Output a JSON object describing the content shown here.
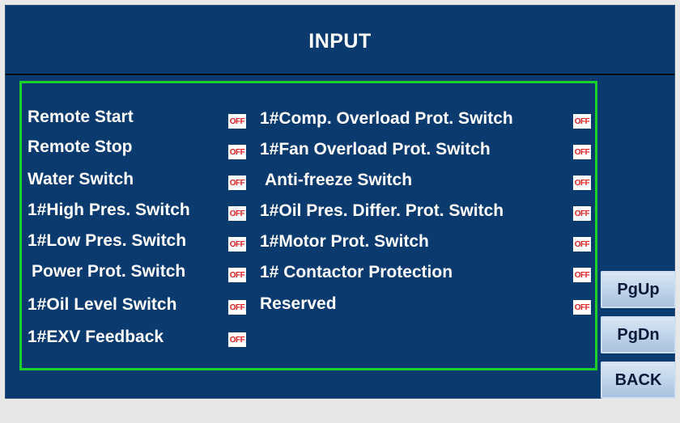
{
  "title": "INPUT",
  "left_items": [
    {
      "label": "Remote Start",
      "status": "OFF"
    },
    {
      "label": "Remote Stop",
      "status": "OFF"
    },
    {
      "label": "Water Switch",
      "status": "OFF"
    },
    {
      "label": "1#High Pres. Switch",
      "status": "OFF"
    },
    {
      "label": "1#Low Pres. Switch",
      "status": "OFF"
    },
    {
      "label": "Power Prot. Switch",
      "status": "OFF"
    },
    {
      "label": "1#Oil Level Switch",
      "status": "OFF"
    },
    {
      "label": "1#EXV Feedback",
      "status": "OFF"
    }
  ],
  "right_items": [
    {
      "label": "1#Comp. Overload Prot. Switch",
      "status": "OFF"
    },
    {
      "label": "1#Fan Overload  Prot. Switch",
      "status": "OFF"
    },
    {
      "label": "Anti-freeze Switch",
      "status": "OFF"
    },
    {
      "label": "1#Oil Pres. Differ. Prot. Switch",
      "status": "OFF"
    },
    {
      "label": "1#Motor Prot. Switch",
      "status": "OFF"
    },
    {
      "label": "1# Contactor Protection",
      "status": "OFF"
    },
    {
      "label": "Reserved",
      "status": "OFF"
    }
  ],
  "buttons": {
    "pgup": "PgUp",
    "pgdn": "PgDn",
    "back": "BACK"
  },
  "colors": {
    "background": "#0b3a6e",
    "panel_border": "#19d12a",
    "off_text": "#e02020"
  }
}
